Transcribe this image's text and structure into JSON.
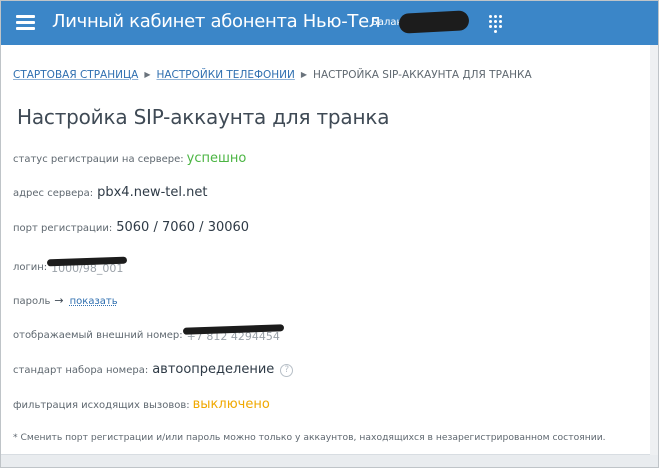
{
  "header": {
    "title": "Личный кабинет абонента Нью-Тел",
    "balance_label": "Баланс:",
    "accent_color": "#3b86c8"
  },
  "breadcrumb": {
    "items": [
      {
        "label": "СТАРТОВАЯ СТРАНИЦА"
      },
      {
        "label": "НАСТРОЙКИ ТЕЛЕФОНИИ"
      },
      {
        "label": "НАСТРОЙКА SIP-АККАУНТА ДЛЯ ТРАНКА"
      }
    ]
  },
  "page_title": "Настройка SIP-аккаунта для транка",
  "fields": {
    "status": {
      "label": "статус регистрации на сервере:",
      "value": "успешно",
      "color": "#4bb543"
    },
    "server": {
      "label": "адрес сервера:",
      "value": "pbx4.new-tel.net"
    },
    "port": {
      "label": "порт регистрации:",
      "value": "5060 / 7060 / 30060"
    },
    "login": {
      "label": "логин:",
      "value": "1000/98_001"
    },
    "password": {
      "label": "пароль",
      "arrow": "→",
      "link": "показать"
    },
    "external_number": {
      "label": "отображаемый внешний номер:",
      "value": "+7 812 4294454"
    },
    "dial_standard": {
      "label": "стандарт набора номера:",
      "value": "автоопределение",
      "help": "?"
    },
    "outgoing_filter": {
      "label": "фильтрация исходящих вызовов:",
      "value": "выключено",
      "color": "#f0a800"
    }
  },
  "footnote": "* Сменить порт регистрации и/или пароль можно только у аккаунтов, находящихся в незарегистрированном состоянии."
}
